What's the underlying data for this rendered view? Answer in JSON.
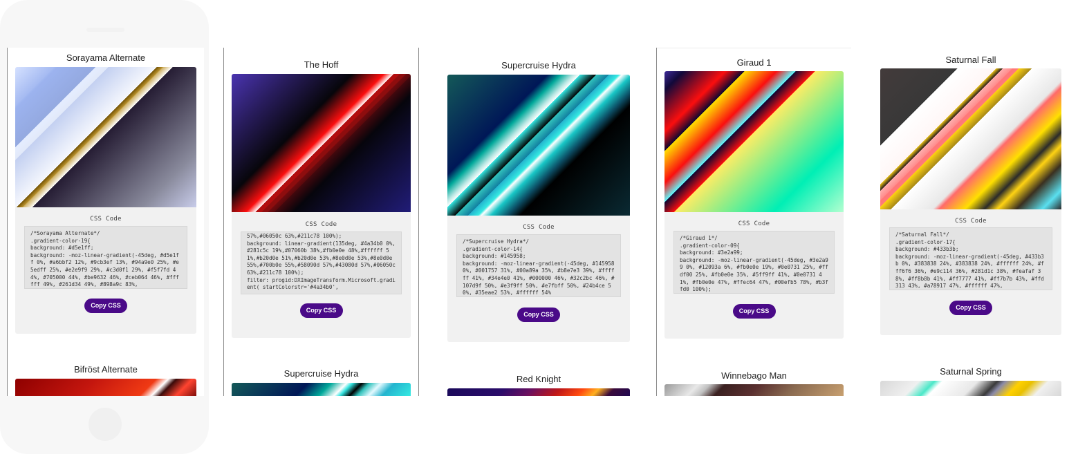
{
  "ui": {
    "css_code_label": "CSS Code",
    "copy_label": "Copy CSS"
  },
  "screens": [
    {
      "title": "Sorayama Alternate",
      "code": "/*Sorayama Alternate*/\n.gradient-color-19{\nbackground: #d5e1ff;\nbackground: -moz-linear-gradient(-45deg, #d5e1ff 0%, #a6bbf2 12%, #9cb3ef 13%, #94a9e0 25%, #e5edff 25%, #e2e9f9 29%, #c3d0f1 29%, #f5f7fd 44%, #705000 44%, #be9632 46%, #ceb064 46%, #ffffff 49%, #261d34 49%, #898a9c 83%,",
      "next_title": "Bifröst Alternate"
    },
    {
      "title": "The Hoff",
      "code": "57%,#06050c 63%,#211c78 100%);\nbackground: linear-gradient(135deg, #4a34b0 0%,#281c5c 19%,#07060b 38%,#fb0e0e 48%,#ffffff 51%,#b20d0e 51%,#b20d0e 53%,#8e0d0e 53%,#8e0d0e 55%,#700b0e 55%,#58090d 57%,#43080d 57%,#06050c 63%,#211c78 100%);\nfilter: progid:DXImageTransform.Microsoft.gradient( startColorstr='#4a34b0',",
      "next_title": "Supercruise Hydra"
    },
    {
      "title": "Supercruise Hydra",
      "code": "/*Supercruise Hydra*/\n.gradient-color-14{\nbackground: #145958;\nbackground: -moz-linear-gradient(-45deg, #145958 0%, #001757 31%, #00a89a 35%, #b8e7e3 39%, #ffffff 41%, #34e4e0 41%, #000000 46%, #32c2bc 46%, #107d9f 50%, #e3f9ff 50%, #e7fbff 50%, #24b4ce 50%, #35eae2 53%, #ffffff 54%",
      "next_title": "Red Knight"
    },
    {
      "title": "Giraud 1",
      "code": "/*Giraud 1*/\n.gradient-color-09{\nbackground: #3e2a99;\nbackground: -moz-linear-gradient(-45deg, #3e2a99 0%, #12093a 6%, #fb0e0e 19%, #0e0731 25%, #ffdf00 25%, #fb0e0e 35%, #5ff9ff 41%, #0e0731 41%, #fb0e0e 47%, #ffec64 47%, #00efb5 78%, #b3ffd0 100%);",
      "next_title": "Winnebago Man"
    },
    {
      "title": "Saturnal Fall",
      "code": "/*Saturnal Fall*/\n.gradient-color-17{\nbackground: #433b3b;\nbackground: -moz-linear-gradient(-45deg, #433b3b 0%, #383838 24%, #383838 24%, #ffffff 24%, #fff6f6 36%, #e9c114 36%, #281d1c 38%, #feafaf 38%, #ff8b8b 41%, #ff7777 41%, #ff7b7b 43%, #ffd313 43%, #a78917 47%, #ffffff 47%,",
      "next_title": "Saturnal Spring"
    }
  ]
}
